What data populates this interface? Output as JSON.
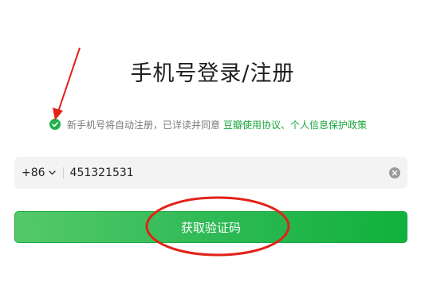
{
  "title": "手机号登录/注册",
  "agreement": {
    "prefix": "新手机号将自动注册，已详读并同意",
    "links": "豆瓣使用协议、个人信息保护政策",
    "checked": true,
    "check_icon": "checkmark-icon"
  },
  "phone": {
    "country_code": "+86",
    "dropdown_icon": "chevron-down-icon",
    "value": "451321531",
    "clear_icon": "clear-icon"
  },
  "get_code_button": {
    "label": "获取验证码"
  },
  "colors": {
    "brand_green": "#1aa63f",
    "annotation_red": "#e32119"
  }
}
